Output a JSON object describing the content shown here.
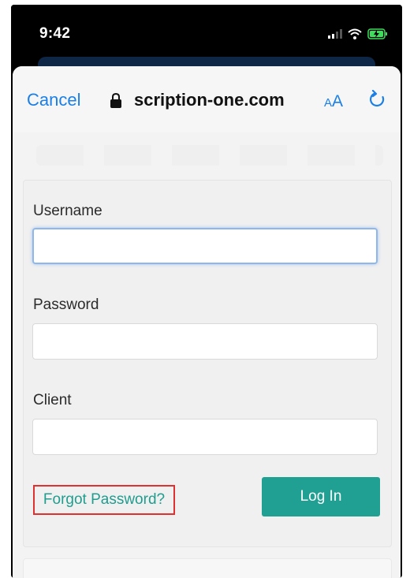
{
  "status_bar": {
    "time": "9:42"
  },
  "browser_bar": {
    "cancel_label": "Cancel",
    "url": "scription-one.com",
    "text_size_small": "A",
    "text_size_large": "A",
    "accent_color": "#1b7fe6"
  },
  "login_form": {
    "username_label": "Username",
    "username_value": "",
    "password_label": "Password",
    "password_value": "",
    "client_label": "Client",
    "client_value": "",
    "forgot_label": "Forgot Password?",
    "login_label": "Log In",
    "button_color": "#1fa093",
    "highlight_color": "#e03131"
  }
}
